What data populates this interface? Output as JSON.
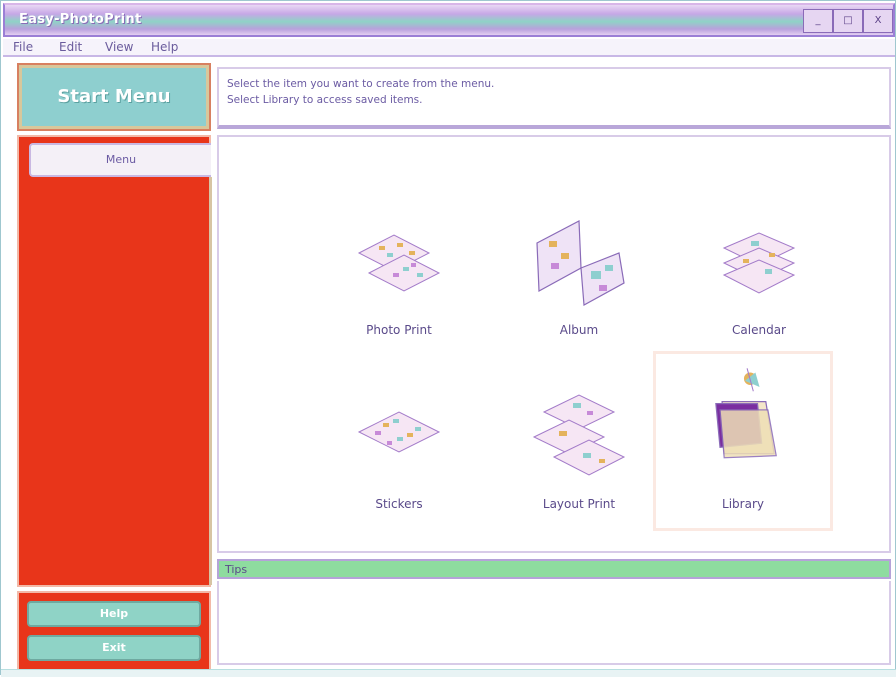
{
  "window": {
    "title": "Easy-PhotoPrint",
    "controls": [
      "_",
      "□",
      "X"
    ]
  },
  "menubar": {
    "items": [
      "File",
      "Edit",
      "View",
      "Help"
    ]
  },
  "logo": {
    "label": "Start Menu"
  },
  "instructions": {
    "line1": "Select the item you want to create from the menu.",
    "line2": "Select Library to access saved items."
  },
  "sidebar": {
    "menu_tab": "Menu",
    "help_button": "Help",
    "exit_button": "Exit"
  },
  "tiles": [
    {
      "label": "Photo Print",
      "icon": "photo-print-icon"
    },
    {
      "label": "Album",
      "icon": "album-icon"
    },
    {
      "label": "Calendar",
      "icon": "calendar-icon"
    },
    {
      "label": "Stickers",
      "icon": "stickers-icon"
    },
    {
      "label": "Layout Print",
      "icon": "layout-print-icon"
    },
    {
      "label": "Library",
      "icon": "library-icon"
    }
  ],
  "tips": {
    "label": "Tips"
  },
  "colors": {
    "sidebar": "#e8351a",
    "accent_teal": "#8ecfcf",
    "tips_bar": "#8edc9f",
    "label_purple": "#5a4a8a"
  }
}
